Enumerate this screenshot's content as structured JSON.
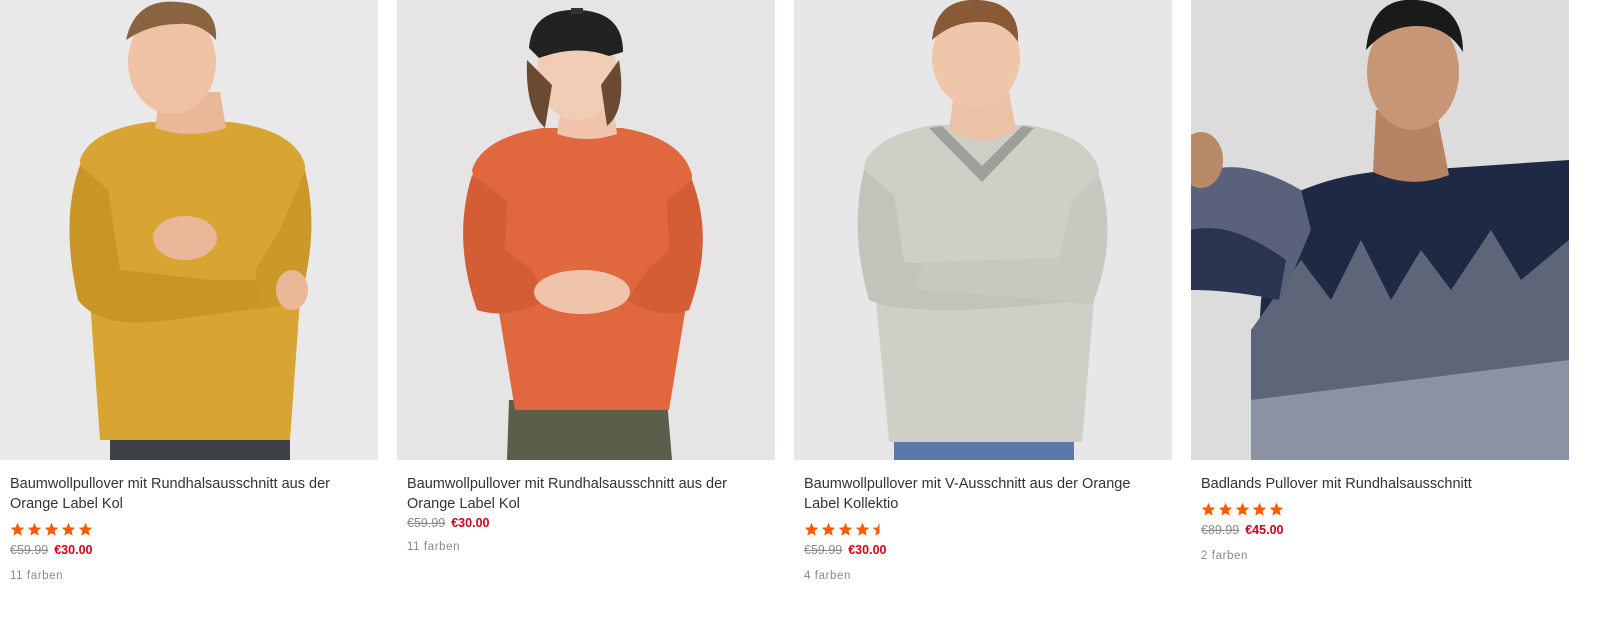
{
  "products": [
    {
      "title": "Baumwollpullover mit Rundhalsausschnitt aus der Orange Label Kol",
      "rating": 5,
      "old_price": "€59.99",
      "new_price": "€30.00",
      "colors": "11 farben",
      "sweater_color": "#d8a532",
      "background_color": "#e9e9ea"
    },
    {
      "title": "Baumwollpullover mit Rundhalsausschnitt aus der Orange Label Kol",
      "rating": null,
      "old_price": "€59.99",
      "new_price": "€30.00",
      "colors": "11 farben",
      "sweater_color": "#e0673e",
      "background_color": "#e6e4e5"
    },
    {
      "title": "Baumwollpullover mit V-Ausschnitt aus der Orange Label Kollektio",
      "rating": 4.5,
      "old_price": "€59.99",
      "new_price": "€30.00",
      "colors": "4 farben",
      "sweater_color": "#cfcfc8",
      "background_color": "#e8e7e8"
    },
    {
      "title": "Badlands Pullover mit Rundhalsausschnitt",
      "rating": 5,
      "old_price": "€89.99",
      "new_price": "€45.00",
      "colors": "2 farben",
      "sweater_color": "#1e2a44",
      "background_color": "#dcdcdc"
    }
  ],
  "theme": {
    "star_color": "#ff5a00",
    "sale_price_color": "#d0021b",
    "muted_text_color": "#8a8a8a"
  }
}
